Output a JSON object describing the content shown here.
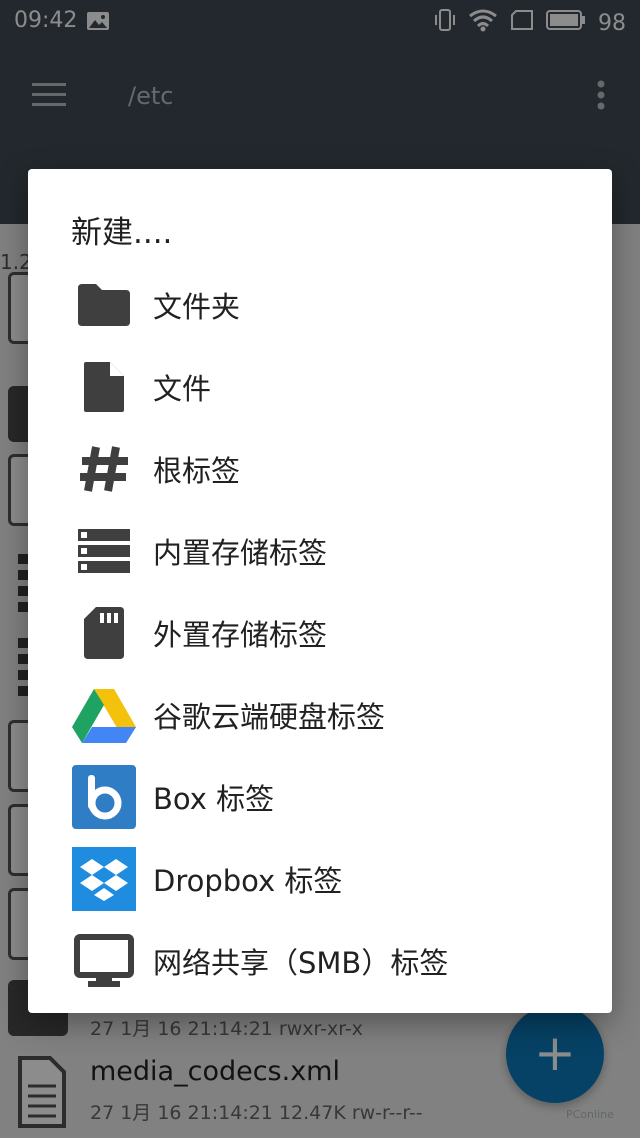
{
  "status_bar": {
    "time": "09:42",
    "battery": "98"
  },
  "app_bar": {
    "path": "/etc"
  },
  "background_list": {
    "size_label": "1.2",
    "rows": [
      {
        "meta": "27 1月 16 21:14:21   rwxr-xr-x"
      },
      {
        "title": "media_codecs.xml",
        "meta": "27 1月 16 21:14:21   12.47K   rw-r--r--"
      }
    ],
    "fab_label": "+",
    "watermark": "PConline"
  },
  "dialog": {
    "title": "新建....",
    "items": [
      {
        "label": "文件夹",
        "icon": "folder-icon"
      },
      {
        "label": "文件",
        "icon": "file-icon"
      },
      {
        "label": "根标签",
        "icon": "hash-icon"
      },
      {
        "label": "内置存储标签",
        "icon": "storage-icon"
      },
      {
        "label": "外置存储标签",
        "icon": "sd-card-icon"
      },
      {
        "label": "谷歌云端硬盘标签",
        "icon": "google-drive-icon"
      },
      {
        "label": "Box 标签",
        "icon": "box-icon"
      },
      {
        "label": "Dropbox 标签",
        "icon": "dropbox-icon"
      },
      {
        "label": "网络共享（SMB）标签",
        "icon": "monitor-icon"
      }
    ]
  },
  "colors": {
    "app_bar": "#3f4a52",
    "accent": "#0c78b8",
    "icon_dark": "#3f3f3f",
    "box_blue": "#2f7ec5",
    "dropbox_blue": "#1f8ce0"
  }
}
